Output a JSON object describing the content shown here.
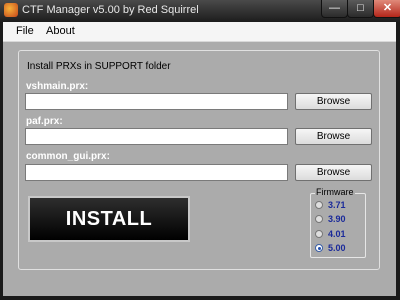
{
  "window": {
    "title": "CTF Manager v5.00 by Red Squirrel",
    "minimize_glyph": "—",
    "maximize_glyph": "□",
    "close_glyph": "✕"
  },
  "menu": {
    "items": [
      "File",
      "About"
    ]
  },
  "group": {
    "legend": "Install PRXs in SUPPORT folder",
    "fields": [
      {
        "label": "vshmain.prx:",
        "value": "",
        "button": "Browse"
      },
      {
        "label": "paf.prx:",
        "value": "",
        "button": "Browse"
      },
      {
        "label": "common_gui.prx:",
        "value": "",
        "button": "Browse"
      }
    ]
  },
  "install_label": "INSTALL",
  "firmware": {
    "legend": "Firmware",
    "options": [
      "3.71",
      "3.90",
      "4.01",
      "5.00"
    ],
    "selected": "5.00"
  }
}
